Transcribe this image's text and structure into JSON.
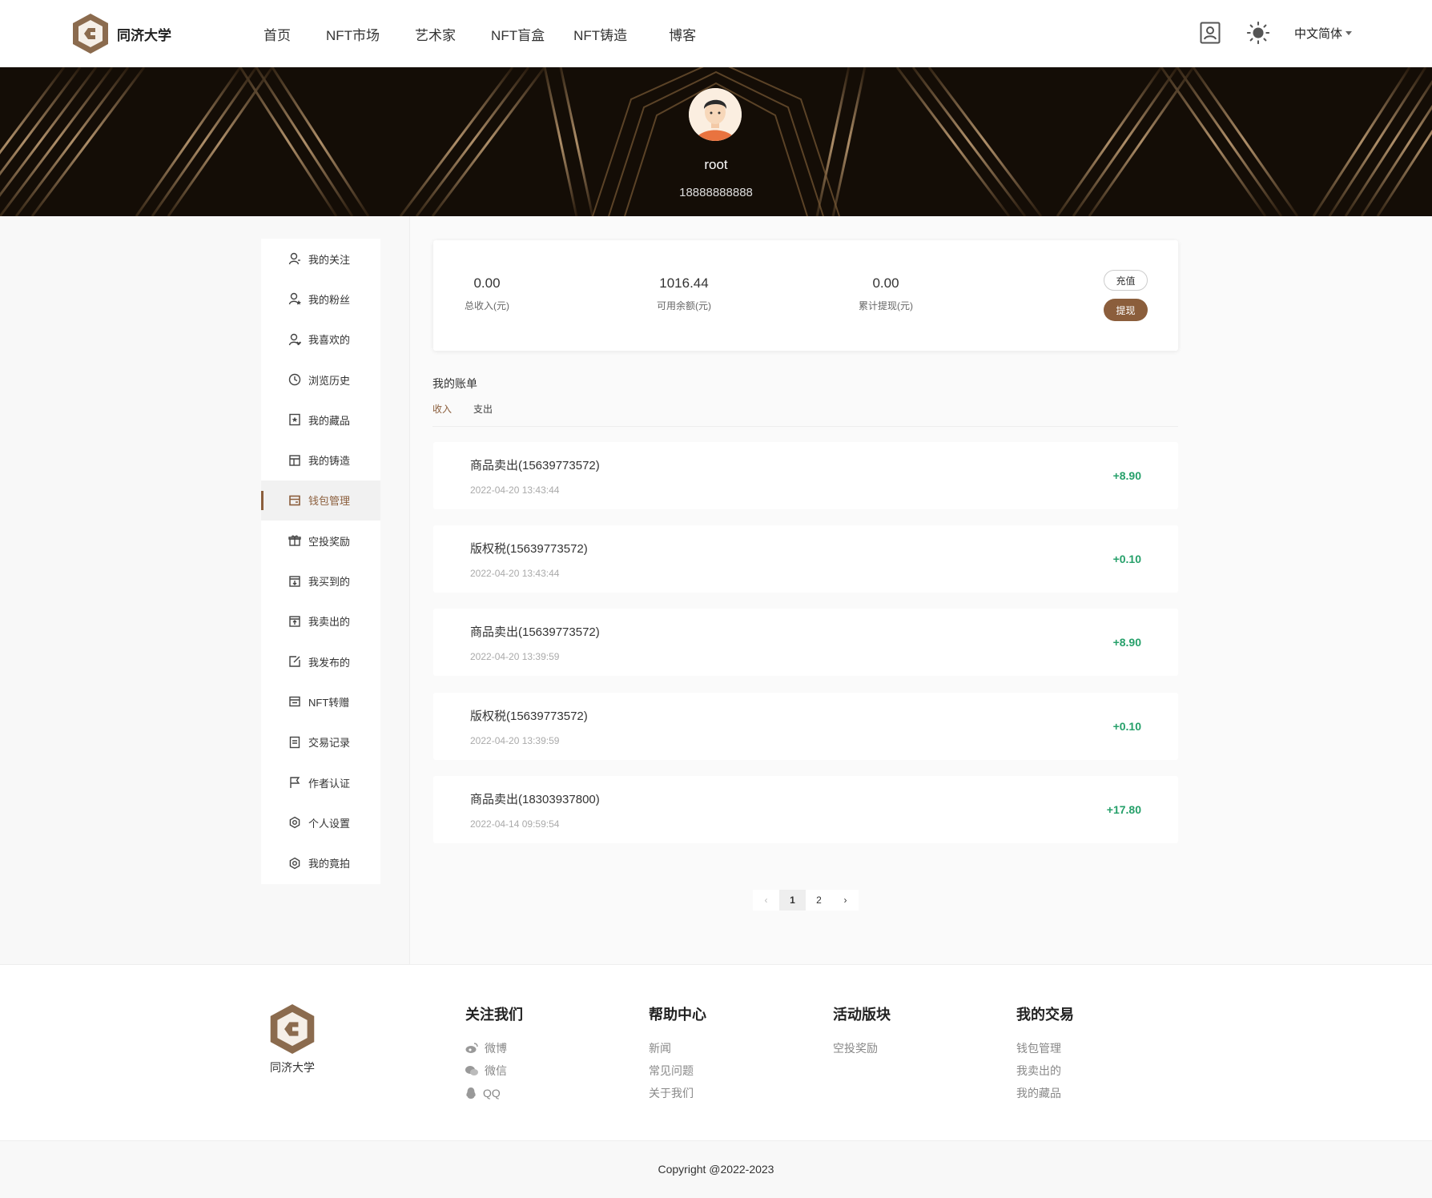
{
  "header": {
    "logo_text": "同济大学",
    "nav": [
      "首页",
      "NFT市场",
      "艺术家",
      "NFT盲盒",
      "NFT铸造",
      "博客"
    ],
    "language": "中文简体"
  },
  "profile": {
    "username": "root",
    "phone": "18888888888"
  },
  "sidebar": {
    "items": [
      {
        "label": "我的关注",
        "icon": "user-follow-icon"
      },
      {
        "label": "我的粉丝",
        "icon": "user-fans-icon"
      },
      {
        "label": "我喜欢的",
        "icon": "user-like-icon"
      },
      {
        "label": "浏览历史",
        "icon": "clock-icon"
      },
      {
        "label": "我的藏品",
        "icon": "bookmark-icon"
      },
      {
        "label": "我的铸造",
        "icon": "layout-icon"
      },
      {
        "label": "钱包管理",
        "icon": "wallet-icon"
      },
      {
        "label": "空投奖励",
        "icon": "gift-icon"
      },
      {
        "label": "我买到的",
        "icon": "download-box-icon"
      },
      {
        "label": "我卖出的",
        "icon": "upload-box-icon"
      },
      {
        "label": "我发布的",
        "icon": "edit-icon"
      },
      {
        "label": "NFT转赠",
        "icon": "transfer-icon"
      },
      {
        "label": "交易记录",
        "icon": "document-icon"
      },
      {
        "label": "作者认证",
        "icon": "flag-icon"
      },
      {
        "label": "个人设置",
        "icon": "settings-icon"
      },
      {
        "label": "我的竟拍",
        "icon": "auction-icon"
      }
    ],
    "active_index": 6
  },
  "wallet": {
    "stats": [
      {
        "value": "0.00",
        "label": "总收入(元)"
      },
      {
        "value": "1016.44",
        "label": "可用余额(元)"
      },
      {
        "value": "0.00",
        "label": "累计提现(元)"
      }
    ],
    "recharge_label": "充值",
    "withdraw_label": "提现"
  },
  "bills": {
    "title": "我的账单",
    "tabs": [
      "收入",
      "支出"
    ],
    "active_tab": 0,
    "rows": [
      {
        "title": "商品卖出(15639773572)",
        "time": "2022-04-20 13:43:44",
        "amount": "+8.90"
      },
      {
        "title": "版权税(15639773572)",
        "time": "2022-04-20 13:43:44",
        "amount": "+0.10"
      },
      {
        "title": "商品卖出(15639773572)",
        "time": "2022-04-20 13:39:59",
        "amount": "+8.90"
      },
      {
        "title": "版权税(15639773572)",
        "time": "2022-04-20 13:39:59",
        "amount": "+0.10"
      },
      {
        "title": "商品卖出(18303937800)",
        "time": "2022-04-14 09:59:54",
        "amount": "+17.80"
      }
    ]
  },
  "pagination": {
    "pages": [
      "1",
      "2"
    ],
    "current": "1"
  },
  "footer": {
    "logo_text": "同济大学",
    "columns": [
      {
        "title": "关注我们",
        "links": [
          {
            "label": "微博",
            "icon": "weibo-icon"
          },
          {
            "label": "微信",
            "icon": "wechat-icon"
          },
          {
            "label": "QQ",
            "icon": "qq-icon"
          }
        ]
      },
      {
        "title": "帮助中心",
        "links": [
          {
            "label": "新闻"
          },
          {
            "label": "常见问题"
          },
          {
            "label": "关于我们"
          }
        ]
      },
      {
        "title": "活动版块",
        "links": [
          {
            "label": "空投奖励"
          }
        ]
      },
      {
        "title": "我的交易",
        "links": [
          {
            "label": "钱包管理"
          },
          {
            "label": "我卖出的"
          },
          {
            "label": "我的藏品"
          }
        ]
      }
    ],
    "copyright": "Copyright @2022-2023"
  },
  "colors": {
    "accent": "#8b5e3c",
    "income": "#26a06a"
  }
}
